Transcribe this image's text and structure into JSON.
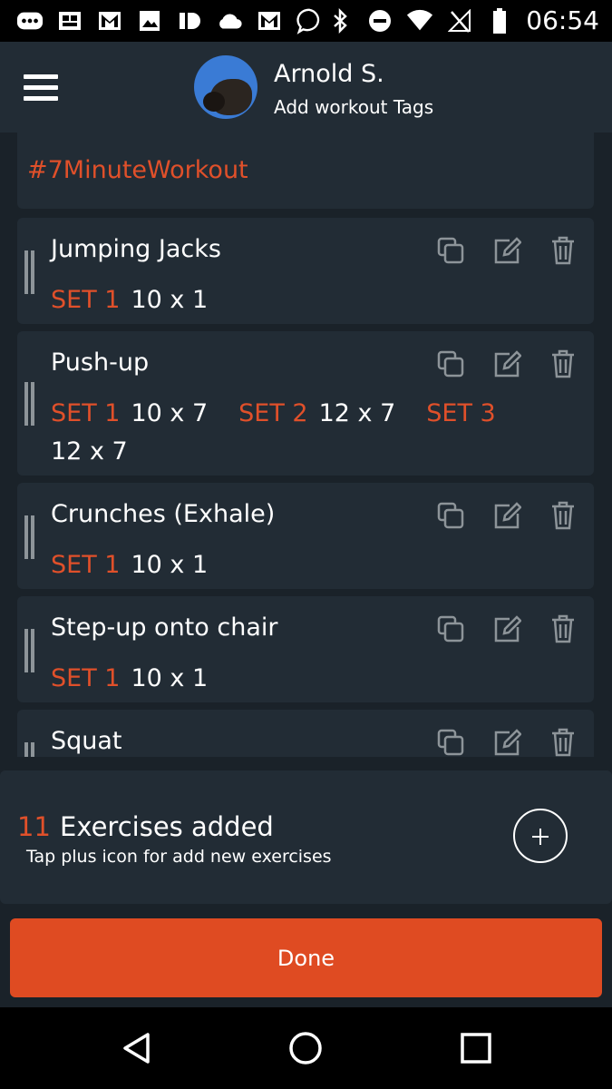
{
  "status_bar": {
    "time": "06:54",
    "icons": [
      "more-icon",
      "gallery-icon",
      "gmail-icon",
      "image-icon",
      "id-icon",
      "cloud-icon",
      "gmail-icon",
      "chat-icon",
      "bluetooth-icon",
      "dnd-icon",
      "wifi-icon",
      "no-signal-icon",
      "battery-icon"
    ]
  },
  "header": {
    "user_name": "Arnold S.",
    "subtitle": "Add workout Tags"
  },
  "tag": "#7MinuteWorkout",
  "exercises": [
    {
      "name": "Jumping Jacks",
      "sets": [
        {
          "label": "SET 1",
          "value": "10 x 1"
        }
      ]
    },
    {
      "name": "Push-up",
      "sets": [
        {
          "label": "SET 1",
          "value": "10 x 7"
        },
        {
          "label": "SET 2",
          "value": "12 x 7"
        },
        {
          "label": "SET 3",
          "value": "12 x 7"
        }
      ]
    },
    {
      "name": "Crunches (Exhale)",
      "sets": [
        {
          "label": "SET 1",
          "value": "10 x 1"
        }
      ]
    },
    {
      "name": "Step-up onto chair",
      "sets": [
        {
          "label": "SET 1",
          "value": "10 x 1"
        }
      ]
    },
    {
      "name": "Squat",
      "sets": []
    }
  ],
  "footer": {
    "count": "11",
    "count_label": "Exercises added",
    "hint": "Tap plus icon for add new exercises"
  },
  "done_label": "Done",
  "colors": {
    "accent": "#e0502a",
    "background": "#1a2229",
    "card": "#222c35",
    "done_button": "#df4b22"
  }
}
